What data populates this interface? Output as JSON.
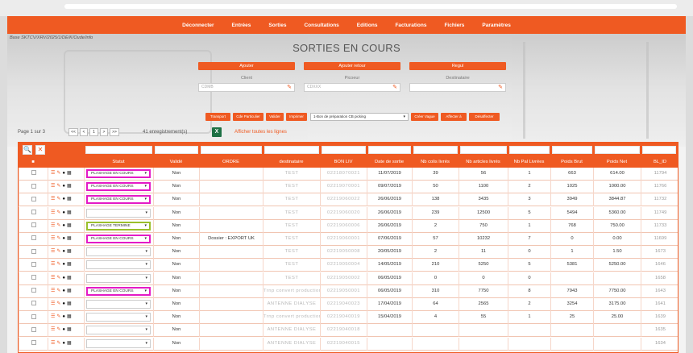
{
  "nav": {
    "items": [
      "Déconnecter",
      "Entrées",
      "Sorties",
      "Consultations",
      "Editions",
      "Facturations",
      "Fichiers",
      "Paramètres"
    ]
  },
  "user_line": "Base SKTCV/XRV/2025/1/DE/K/Oude/info",
  "page_title": "SORTIES EN COURS",
  "filters": [
    {
      "button": "Ajouter",
      "label": "Client",
      "value": "CDMB"
    },
    {
      "button": "Ajouter retour",
      "label": "Picoeur",
      "value": "CDXXX"
    },
    {
      "button": "Regul",
      "label": "Destinataire",
      "value": ""
    }
  ],
  "actions": {
    "buttons": [
      "Transport",
      "Cde Particulier",
      "Valider",
      "Imprimer",
      "Créer Vague",
      "Affecter à",
      "Désaffecter"
    ],
    "select_value": "1-Bon de préparation CB picking"
  },
  "pager": {
    "info": "Page 1 sur 3",
    "buttons": [
      "<<",
      "<",
      "1",
      ">",
      ">>"
    ],
    "count": "41 enregistrement(s)",
    "excel": "X",
    "show_all": "Afficher toutes les lignes"
  },
  "search": {
    "search_icon": "🔍",
    "clear_icon": "✕"
  },
  "table": {
    "headers": [
      "■",
      "",
      "Statut",
      "Validé",
      "ORDRE",
      "destinataire",
      "BON LIV",
      "Date de sortie",
      "Nb colis livrés",
      "Nb articles livrés",
      "Nb Pal Livrées",
      "Poids Brut",
      "Poids Net",
      "BL_ID"
    ],
    "rows": [
      {
        "statut": "PLASHAGE EN COURS",
        "statut_type": "encours",
        "valide": "Non",
        "ordre": "",
        "dest": "TEST",
        "bon": "02218070021",
        "date": "11/07/2019",
        "colis": "39",
        "articles": "56",
        "pal": "1",
        "brut": "663",
        "net": "614.00",
        "bl": "11794"
      },
      {
        "statut": "PLASHAGE EN COURS",
        "statut_type": "encours",
        "valide": "Non",
        "ordre": "",
        "dest": "TEST",
        "bon": "02219070001",
        "date": "09/07/2019",
        "colis": "50",
        "articles": "1100",
        "pal": "2",
        "brut": "1025",
        "net": "1000.00",
        "bl": "11766"
      },
      {
        "statut": "PLASHAGE EN COURS",
        "statut_type": "encours",
        "valide": "Non",
        "ordre": "",
        "dest": "TEST",
        "bon": "02219060022",
        "date": "26/06/2019",
        "colis": "138",
        "articles": "3435",
        "pal": "3",
        "brut": "3949",
        "net": "3844.87",
        "bl": "11732"
      },
      {
        "statut": "",
        "statut_type": "plain",
        "valide": "Non",
        "ordre": "",
        "dest": "TEST",
        "bon": "02219060020",
        "date": "26/06/2019",
        "colis": "239",
        "articles": "12500",
        "pal": "5",
        "brut": "5494",
        "net": "5360.00",
        "bl": "11749"
      },
      {
        "statut": "PLASHAGE TERMINE",
        "statut_type": "termine",
        "valide": "Non",
        "ordre": "",
        "dest": "TEST",
        "bon": "02219060006",
        "date": "26/06/2019",
        "colis": "2",
        "articles": "750",
        "pal": "1",
        "brut": "768",
        "net": "750.00",
        "bl": "11733"
      },
      {
        "statut": "PLASHAGE EN COURS",
        "statut_type": "encours",
        "valide": "Non",
        "ordre": "Dossier : EXPORT UK",
        "dest": "TEST",
        "bon": "02219060001",
        "date": "07/06/2019",
        "colis": "57",
        "articles": "10232",
        "pal": "7",
        "brut": "0",
        "net": "0.00",
        "bl": "11699"
      },
      {
        "statut": "",
        "statut_type": "plain",
        "valide": "Non",
        "ordre": "",
        "dest": "TEST",
        "bon": "02219050008",
        "date": "20/05/2019",
        "colis": "2",
        "articles": "11",
        "pal": "0",
        "brut": "1",
        "net": "1.50",
        "bl": "1673"
      },
      {
        "statut": "",
        "statut_type": "plain",
        "valide": "Non",
        "ordre": "",
        "dest": "TEST",
        "bon": "02219050004",
        "date": "14/05/2019",
        "colis": "210",
        "articles": "5250",
        "pal": "5",
        "brut": "5381",
        "net": "5250.00",
        "bl": "1646"
      },
      {
        "statut": "",
        "statut_type": "plain",
        "valide": "Non",
        "ordre": "",
        "dest": "TEST",
        "bon": "02219050002",
        "date": "06/05/2019",
        "colis": "0",
        "articles": "0",
        "pal": "0",
        "brut": "",
        "net": "",
        "bl": "1658"
      },
      {
        "statut": "PLASHAGE EN COURS",
        "statut_type": "encours",
        "valide": "Non",
        "ordre": "",
        "dest": "Trnp convert production",
        "bon": "02219050001",
        "date": "06/05/2019",
        "colis": "310",
        "articles": "7750",
        "pal": "8",
        "brut": "7943",
        "net": "7750.00",
        "bl": "1643"
      },
      {
        "statut": "",
        "statut_type": "plain",
        "valide": "Non",
        "ordre": "",
        "dest": "ANTENNE DIALYSE",
        "bon": "02219040023",
        "date": "17/04/2019",
        "colis": "64",
        "articles": "2565",
        "pal": "2",
        "brut": "3254",
        "net": "3175.00",
        "bl": "1641"
      },
      {
        "statut": "",
        "statut_type": "plain",
        "valide": "Non",
        "ordre": "",
        "dest": "Trnp convert production",
        "bon": "02219040019",
        "date": "15/04/2019",
        "colis": "4",
        "articles": "55",
        "pal": "1",
        "brut": "25",
        "net": "25.00",
        "bl": "1639"
      },
      {
        "statut": "",
        "statut_type": "plain",
        "valide": "Non",
        "ordre": "",
        "dest": "ANTENNE DIALYSE",
        "bon": "02219040018",
        "date": "",
        "colis": "",
        "articles": "",
        "pal": "",
        "brut": "",
        "net": "",
        "bl": "1635"
      },
      {
        "statut": "",
        "statut_type": "plain",
        "valide": "Non",
        "ordre": "",
        "dest": "ANTENNE DIALYSE",
        "bon": "02219040015",
        "date": "",
        "colis": "",
        "articles": "",
        "pal": "",
        "brut": "",
        "net": "",
        "bl": "1634"
      }
    ]
  },
  "colors": {
    "accent": "#ef5a22",
    "encours_border": "#e41ac6",
    "termine_border": "#9bbf2b",
    "excel": "#1e7145"
  }
}
